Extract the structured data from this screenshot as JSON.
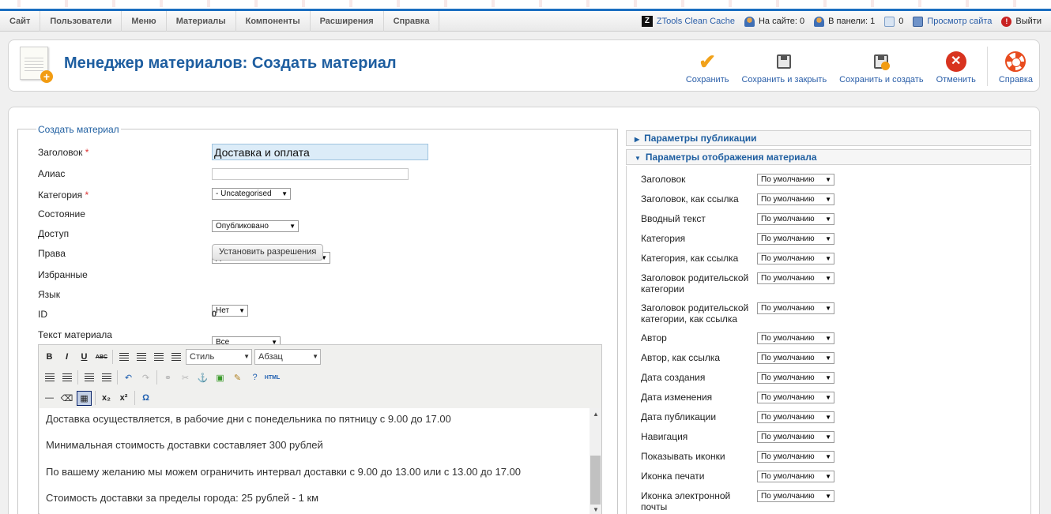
{
  "menu": [
    "Сайт",
    "Пользователи",
    "Меню",
    "Материалы",
    "Компоненты",
    "Расширения",
    "Справка"
  ],
  "status": {
    "cache": "ZTools Clean Cache",
    "on_site": "На сайте: 0",
    "in_panel": "В панели: 1",
    "messages": "0",
    "view_site": "Просмотр сайта",
    "logout": "Выйти"
  },
  "header": {
    "title": "Менеджер материалов: Создать материал"
  },
  "toolbar": {
    "save": "Сохранить",
    "save_close": "Сохранить и закрыть",
    "save_new": "Сохранить и создать",
    "cancel": "Отменить",
    "help": "Справка"
  },
  "form": {
    "legend": "Создать материал",
    "title_label": "Заголовок",
    "title_value": "Доставка и оплата",
    "alias_label": "Алиас",
    "alias_value": "",
    "category_label": "Категория",
    "category_value": "- Uncategorised",
    "state_label": "Состояние",
    "state_value": "Опубликовано",
    "access_label": "Доступ",
    "access_value": "Для всех",
    "rights_label": "Права",
    "rights_button": "Установить разрешения",
    "featured_label": "Избранные",
    "featured_value": "Нет",
    "language_label": "Язык",
    "language_value": "Все",
    "id_label": "ID",
    "id_value": "0",
    "text_label": "Текст материала",
    "required_mark": "*"
  },
  "editor": {
    "style_select": "Стиль",
    "format_select": "Абзац",
    "html_label": "HTML",
    "paragraphs": [
      "Доставка осуществляется, в рабочие дни с понедельника по пятницу с 9.00 до 17.00",
      "Минимальная стоимость доставки составляет 300 рублей",
      "По вашему желанию мы можем ограничить интервал доставки с 9.00 до 13.00 или с 13.00 до 17.00",
      "Стоимость доставки за пределы города: 25 рублей - 1 км"
    ]
  },
  "panels": {
    "publishing": "Параметры публикации",
    "display": "Параметры отображения материала"
  },
  "options": [
    {
      "label": "Заголовок",
      "value": "По умолчанию"
    },
    {
      "label": "Заголовок, как ссылка",
      "value": "По умолчанию"
    },
    {
      "label": "Вводный текст",
      "value": "По умолчанию"
    },
    {
      "label": "Категория",
      "value": "По умолчанию"
    },
    {
      "label": "Категория, как ссылка",
      "value": "По умолчанию"
    },
    {
      "label": "Заголовок родительской категории",
      "value": "По умолчанию"
    },
    {
      "label": "Заголовок родительской категории, как ссылка",
      "value": "По умолчанию"
    },
    {
      "label": "Автор",
      "value": "По умолчанию"
    },
    {
      "label": "Автор, как ссылка",
      "value": "По умолчанию"
    },
    {
      "label": "Дата создания",
      "value": "По умолчанию"
    },
    {
      "label": "Дата изменения",
      "value": "По умолчанию"
    },
    {
      "label": "Дата публикации",
      "value": "По умолчанию"
    },
    {
      "label": "Навигация",
      "value": "По умолчанию"
    },
    {
      "label": "Показывать иконки",
      "value": "По умолчанию"
    },
    {
      "label": "Иконка печати",
      "value": "По умолчанию"
    },
    {
      "label": "Иконка электронной почты",
      "value": "По умолчанию"
    }
  ],
  "colors": {
    "accent": "#1e5ea0",
    "top_border": "#1a6ec1",
    "title_field": "#dcecf8"
  }
}
